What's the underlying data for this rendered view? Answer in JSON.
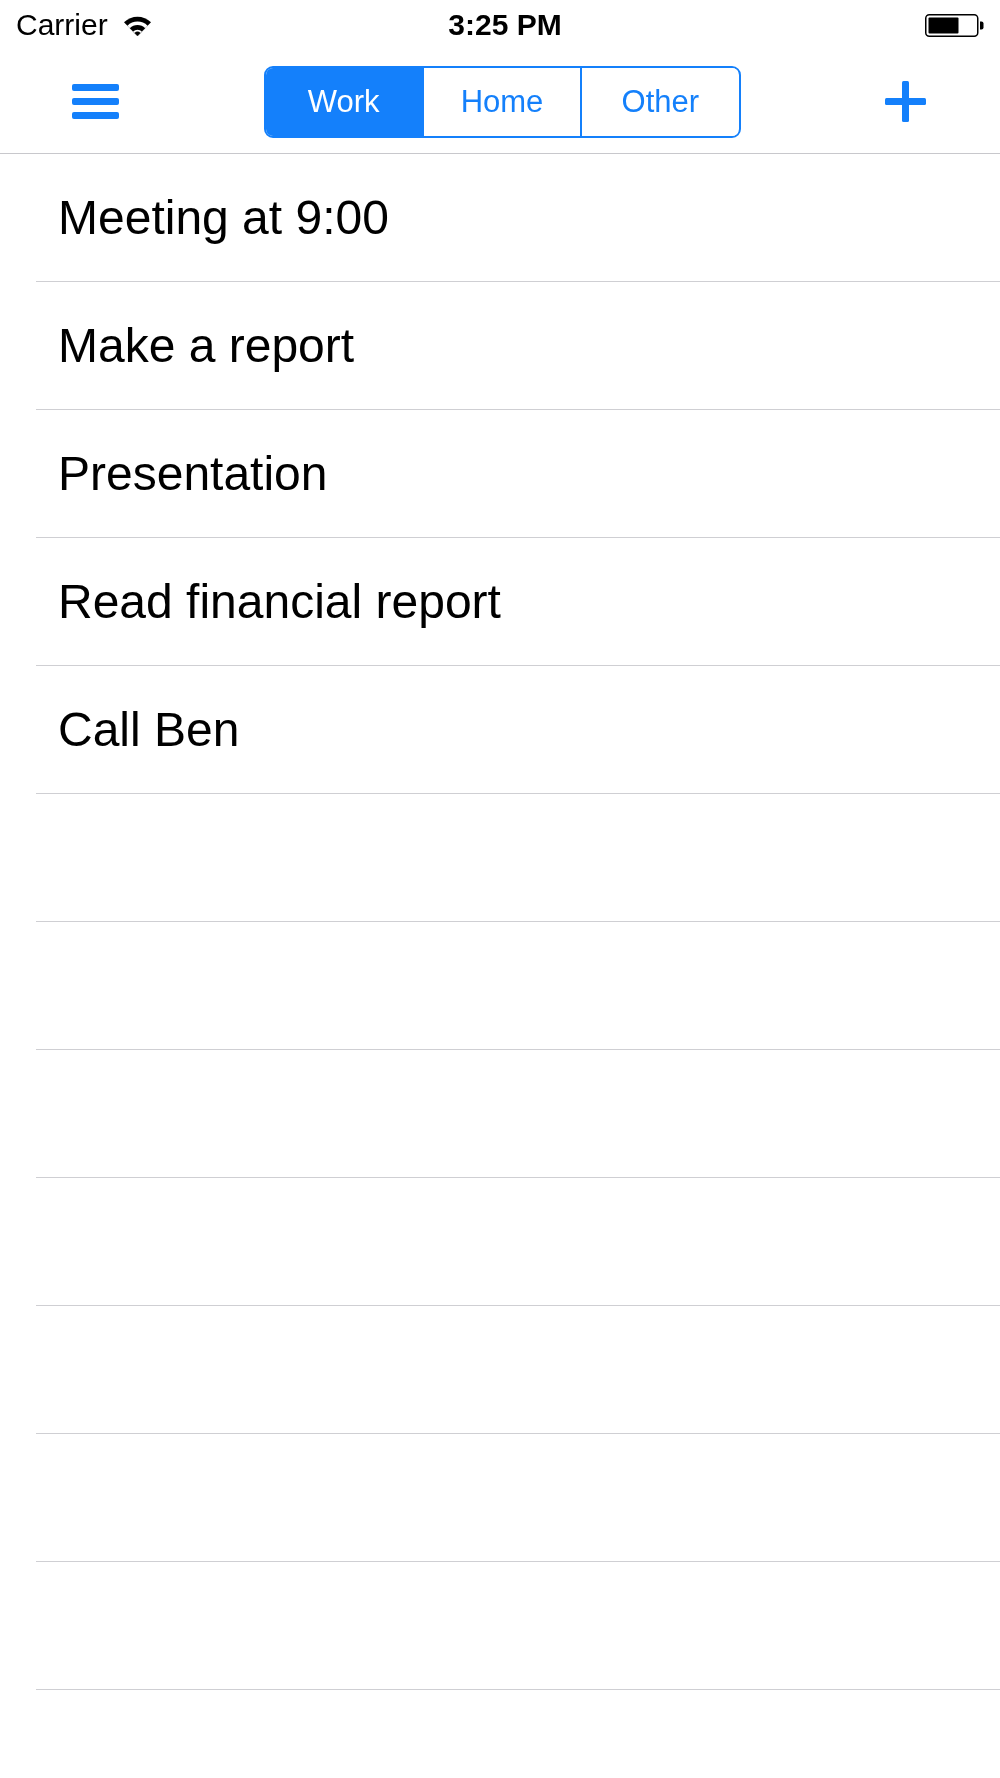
{
  "status_bar": {
    "carrier": "Carrier",
    "time": "3:25 PM"
  },
  "nav_bar": {
    "segments": [
      {
        "label": "Work",
        "selected": true
      },
      {
        "label": "Home",
        "selected": false
      },
      {
        "label": "Other",
        "selected": false
      }
    ]
  },
  "tasks": [
    {
      "title": "Meeting at 9:00"
    },
    {
      "title": "Make a report"
    },
    {
      "title": "Presentation"
    },
    {
      "title": "Read financial report"
    },
    {
      "title": "Call Ben"
    }
  ]
}
